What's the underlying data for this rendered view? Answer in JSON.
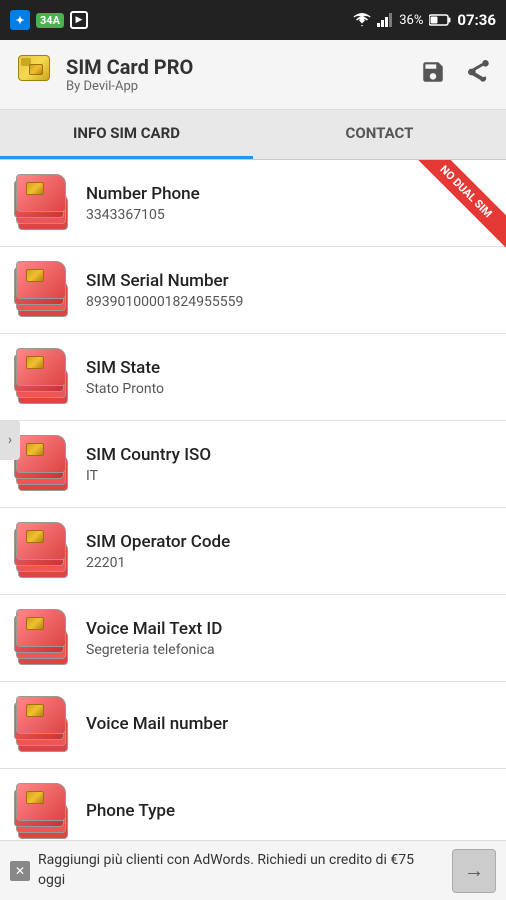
{
  "statusBar": {
    "notification_label": "34A",
    "time": "07:36",
    "battery": "36%"
  },
  "header": {
    "title": "SIM Card PRO",
    "subtitle": "By Devil-App",
    "save_label": "💾",
    "share_label": "⎘"
  },
  "tabs": [
    {
      "id": "info",
      "label": "INFO SIM CARD",
      "active": true
    },
    {
      "id": "contact",
      "label": "CONTACT",
      "active": false
    }
  ],
  "badge": {
    "line1": "NO DUAL",
    "line2": "SIM"
  },
  "infoRows": [
    {
      "label": "Number Phone",
      "value": "3343367105"
    },
    {
      "label": "SIM  Serial Number",
      "value": "89390100001824955559"
    },
    {
      "label": "SIM State",
      "value": "Stato Pronto"
    },
    {
      "label": "SIM Country ISO",
      "value": "IT"
    },
    {
      "label": "SIM Operator Code",
      "value": "22201"
    },
    {
      "label": "Voice Mail Text ID",
      "value": "Segreteria telefonica"
    },
    {
      "label": "Voice Mail number",
      "value": ""
    },
    {
      "label": "Phone Type",
      "value": ""
    }
  ],
  "adBanner": {
    "text": "Raggiungi più clienti con AdWords. Richiedi un credito di €75 oggi",
    "close_label": "✕",
    "arrow_label": "→"
  }
}
